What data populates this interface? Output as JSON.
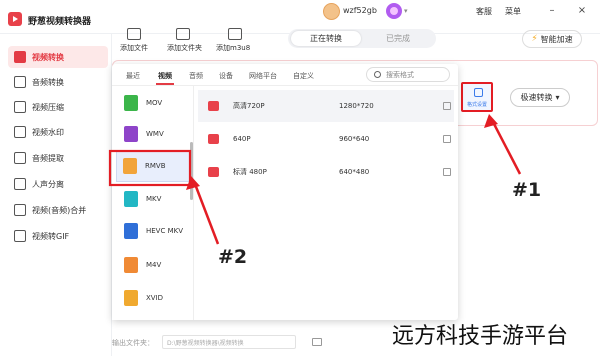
{
  "app": {
    "title": "野葱视频转换器"
  },
  "user": {
    "name": "wzf52gb"
  },
  "header": {
    "support": "客服",
    "menu": "菜单"
  },
  "window_controls": {
    "minimize": "–",
    "close": "×"
  },
  "sidebar": {
    "items": [
      {
        "label": "视频转换",
        "active": true
      },
      {
        "label": "音频转换"
      },
      {
        "label": "视频压缩"
      },
      {
        "label": "视频水印"
      },
      {
        "label": "音频提取"
      },
      {
        "label": "人声分离"
      },
      {
        "label": "视频(音频)合并"
      },
      {
        "label": "视频转GIF"
      }
    ]
  },
  "toolbar": {
    "add_file": "添加文件",
    "add_folder": "添加文件夹",
    "add_m3u8": "添加m3u8",
    "tab_converting": "正在转换",
    "tab_done": "已完成",
    "accelerate": "智能加速",
    "accelerate_icon": "⚡"
  },
  "format_popup": {
    "tabs": [
      "最近",
      "视频",
      "音频",
      "设备",
      "网络平台",
      "自定义"
    ],
    "active_tab": "视频",
    "search_placeholder": "搜索格式",
    "formats": [
      {
        "name": "MOV",
        "color": "#3bb54a"
      },
      {
        "name": "WMV",
        "color": "#8e44c9"
      },
      {
        "name": "RMVB",
        "color": "#f2a43a",
        "selected": true
      },
      {
        "name": "MKV",
        "color": "#22b7c4"
      },
      {
        "name": "HEVC MKV",
        "color": "#2f6fd8"
      },
      {
        "name": "M4V",
        "color": "#f08a35"
      },
      {
        "name": "XVID",
        "color": "#f0a92f"
      }
    ],
    "resolutions": [
      {
        "name": "高清720P",
        "dims": "1280*720"
      },
      {
        "name": "640P",
        "dims": "960*640"
      },
      {
        "name": "标清 480P",
        "dims": "640*480"
      }
    ]
  },
  "task": {
    "settings_label": "格式设置",
    "convert_button": "极速转换",
    "dropdown_icon": "▾"
  },
  "output": {
    "label": "输出文件夹：",
    "path": "D:\\野葱视频转换器\\视频转换"
  },
  "annotations": {
    "one": "#1",
    "two": "#2"
  },
  "watermark": "远方科技手游平台",
  "colors": {
    "accent": "#e33b44",
    "annotation_red": "#e31d24"
  }
}
